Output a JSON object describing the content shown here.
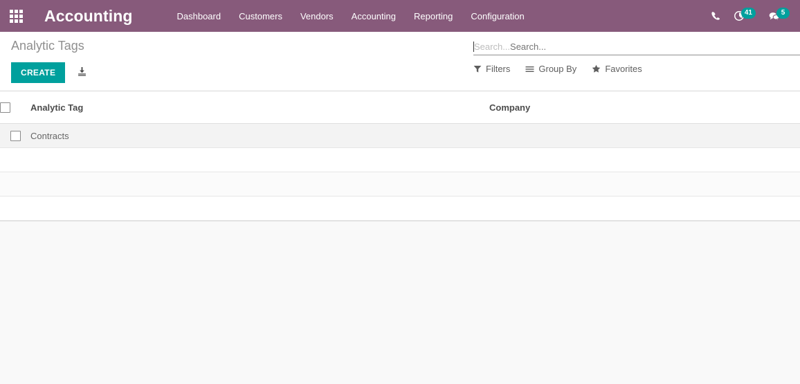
{
  "navbar": {
    "apps_icon": "apps-grid-icon",
    "brand": "Accounting",
    "menu_items": [
      {
        "label": "Dashboard"
      },
      {
        "label": "Customers"
      },
      {
        "label": "Vendors"
      },
      {
        "label": "Accounting"
      },
      {
        "label": "Reporting"
      },
      {
        "label": "Configuration"
      }
    ],
    "right_icons": [
      {
        "name": "phone-icon",
        "badge": null
      },
      {
        "name": "activity-clock-icon",
        "badge": "41"
      },
      {
        "name": "messages-icon",
        "badge": "5"
      }
    ],
    "accent_color": "#875a7b",
    "badge_color": "#00a09d"
  },
  "control_panel": {
    "title": "Analytic Tags",
    "create_label": "CREATE",
    "create_color": "#00a09d",
    "import_icon": "import-download-icon",
    "search": {
      "placeholder": "Search...",
      "value": ""
    },
    "filters": [
      {
        "label": "Filters",
        "icon": "filter-funnel-icon"
      },
      {
        "label": "Group By",
        "icon": "group-by-lines-icon"
      },
      {
        "label": "Favorites",
        "icon": "star-icon"
      }
    ]
  },
  "list": {
    "columns": [
      {
        "key": "analytic_tag",
        "label": "Analytic Tag"
      },
      {
        "key": "company",
        "label": "Company"
      }
    ],
    "rows": [
      {
        "analytic_tag": "Contracts",
        "company": ""
      }
    ],
    "filler_row_count": 3
  }
}
